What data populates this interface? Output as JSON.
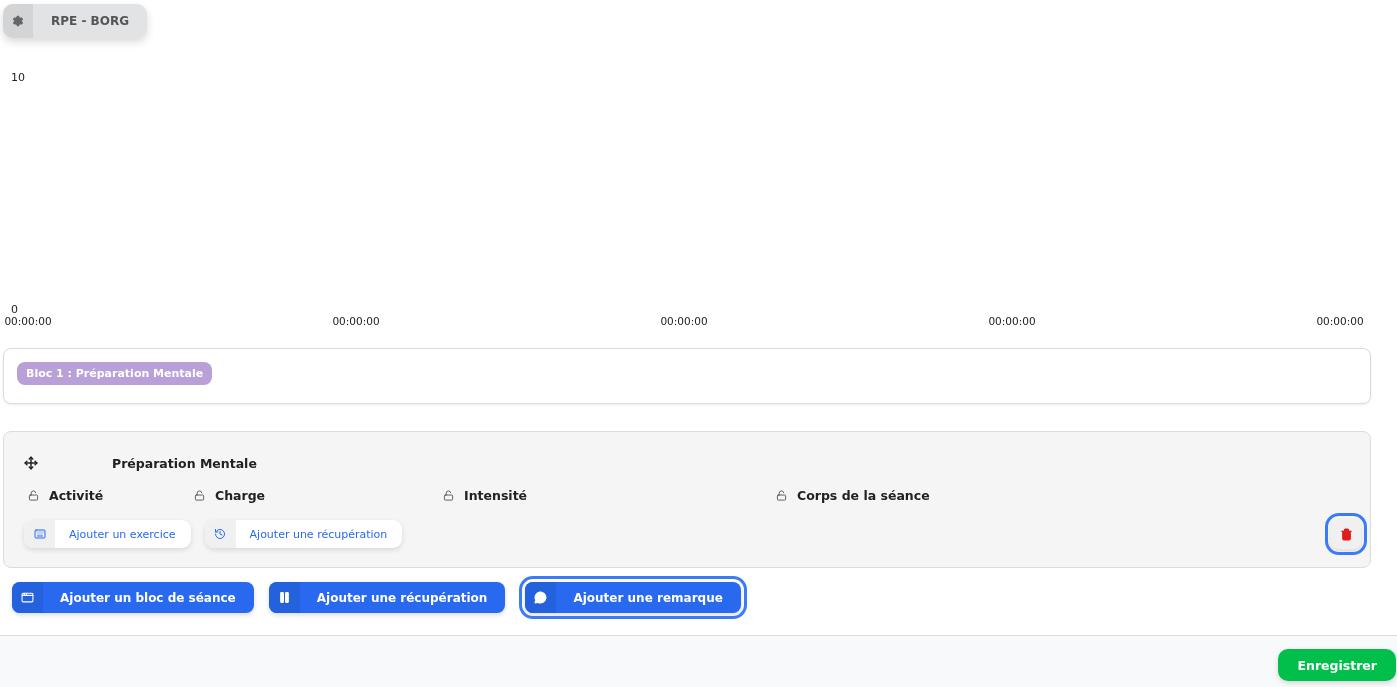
{
  "mode_button": {
    "label": "RPE - BORG"
  },
  "chart": {
    "chart_data": {
      "type": "line",
      "ylim": [
        0,
        10
      ],
      "yticks": [
        0,
        10
      ],
      "categories": [
        "00:00:00",
        "00:00:00",
        "00:00:00",
        "00:00:00",
        "00:00:00"
      ]
    }
  },
  "block": {
    "tag": "Bloc 1 : Préparation Mentale"
  },
  "exercise": {
    "title": "Préparation Mentale",
    "fields": [
      {
        "label": "Activité",
        "locked": false
      },
      {
        "label": "Charge",
        "locked": false
      },
      {
        "label": "Intensité",
        "locked": false
      },
      {
        "label": "Corps de la séance",
        "locked": false
      }
    ],
    "buttons": [
      {
        "label": "Ajouter un exercice"
      },
      {
        "label": "Ajouter une récupération"
      }
    ],
    "delete_button": {
      "focused": true
    }
  },
  "actions": [
    {
      "label": "Ajouter un bloc de séance",
      "focused": false
    },
    {
      "label": "Ajouter une récupération",
      "focused": false
    },
    {
      "label": "Ajouter une remarque",
      "focused": true
    }
  ],
  "footer": {
    "save_button": "Enregistrer"
  }
}
